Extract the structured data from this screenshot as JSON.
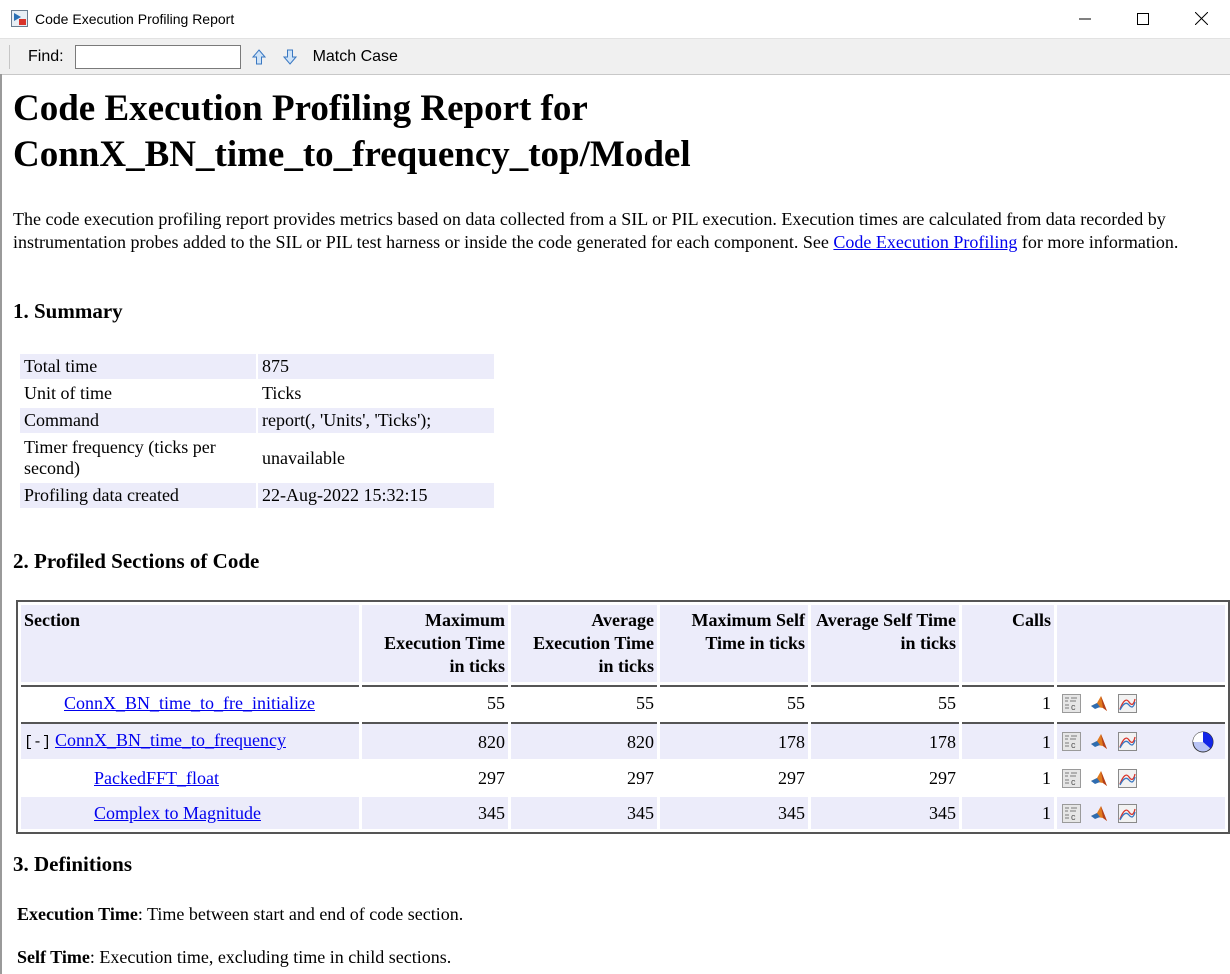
{
  "window": {
    "title": "Code Execution Profiling Report",
    "controls": [
      "minimize",
      "maximize",
      "close"
    ]
  },
  "toolbar": {
    "find_label": "Find:",
    "find_value": "",
    "find_placeholder": "",
    "prev_icon": "arrow-up-icon",
    "next_icon": "arrow-down-icon",
    "match_case_label": "Match Case"
  },
  "report": {
    "title_line1": "Code Execution Profiling Report for",
    "title_line2": "ConnX_BN_time_to_frequency_top/Model",
    "intro_text": "The code execution profiling report provides metrics based on data collected from a SIL or PIL execution. Execution times are calculated from data recorded by instrumentation probes added to the SIL or PIL test harness or inside the code generated for each component. See ",
    "intro_link": "Code Execution Profiling",
    "intro_tail": " for more information."
  },
  "summary": {
    "heading": "1. Summary",
    "rows": [
      {
        "key": "Total time",
        "value": "875"
      },
      {
        "key": "Unit of time",
        "value": "Ticks"
      },
      {
        "key": "Command",
        "value": "report(, 'Units', 'Ticks');"
      },
      {
        "key": "Timer frequency (ticks per second)",
        "value": "unavailable"
      },
      {
        "key": "Profiling data created",
        "value": "22-Aug-2022 15:32:15"
      }
    ]
  },
  "profiled": {
    "heading": "2. Profiled Sections of Code",
    "columns": [
      "Section",
      "Maximum Execution Time in ticks",
      "Average Execution Time in ticks",
      "Maximum Self Time in ticks",
      "Average Self Time in ticks",
      "Calls"
    ],
    "rows": [
      {
        "toggle": "",
        "name": "ConnX_BN_time_to_fre_initialize",
        "max_exec": "55",
        "avg_exec": "55",
        "max_self": "55",
        "avg_self": "55",
        "calls": "1",
        "pie": false
      },
      {
        "toggle": "[-]",
        "name": "ConnX_BN_time_to_frequency",
        "max_exec": "820",
        "avg_exec": "820",
        "max_self": "178",
        "avg_self": "178",
        "calls": "1",
        "pie": true
      },
      {
        "toggle": "",
        "name": "PackedFFT_float",
        "max_exec": "297",
        "avg_exec": "297",
        "max_self": "297",
        "avg_self": "297",
        "calls": "1",
        "pie": false
      },
      {
        "toggle": "",
        "name": "Complex to Magnitude",
        "max_exec": "345",
        "avg_exec": "345",
        "max_self": "345",
        "avg_self": "345",
        "calls": "1",
        "pie": false
      }
    ],
    "row_icons": [
      "code-icon",
      "matlab-icon",
      "plot-icon"
    ]
  },
  "definitions": {
    "heading": "3. Definitions",
    "items": [
      {
        "term": "Execution Time",
        "text": ": Time between start and end of code section."
      },
      {
        "term": "Self Time",
        "text": ": Execution time, excluding time in child sections."
      }
    ]
  }
}
